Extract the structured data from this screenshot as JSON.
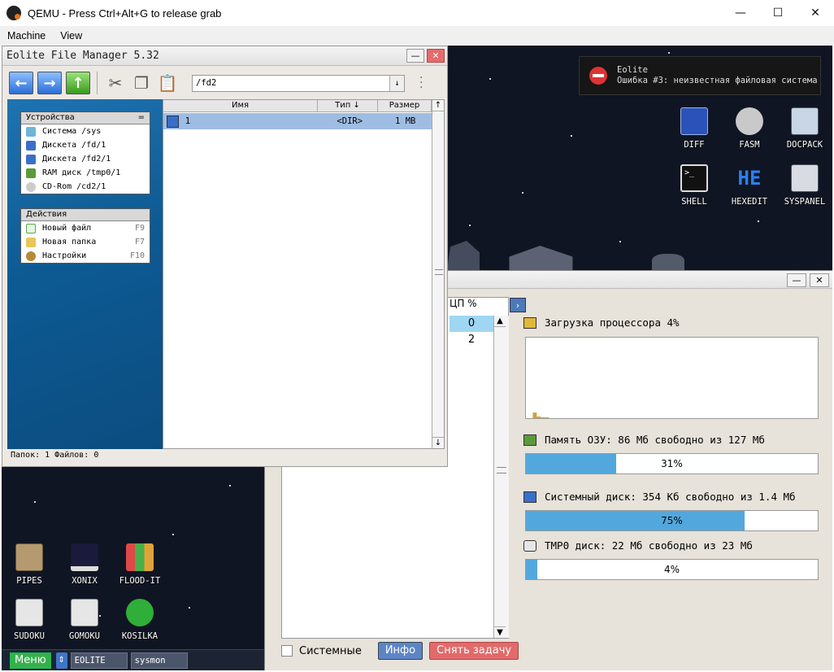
{
  "qemu": {
    "title": "QEMU - Press Ctrl+Alt+G to release grab",
    "menu": [
      "Machine",
      "View"
    ],
    "controls": {
      "minimize": "—",
      "maximize": "☐",
      "close": "✕"
    }
  },
  "notification": {
    "app": "Eolite",
    "message": "Ошибка #3: неизвестная файловая система"
  },
  "desktop_icons": [
    {
      "label": "DIFF",
      "icon": "diff-icon",
      "color": "#2b52b8"
    },
    {
      "label": "FASM",
      "icon": "fasm-icon",
      "color": "#c9c9c9"
    },
    {
      "label": "DOCPACK",
      "icon": "docpack-icon",
      "color": "#c8d6e6"
    },
    {
      "label": "SHELL",
      "icon": "shell-icon",
      "color": "#111111"
    },
    {
      "label": "HEXEDIT",
      "icon": "hexedit-icon",
      "color": "#1f6bd9"
    },
    {
      "label": "SYSPANEL",
      "icon": "syspanel-icon",
      "color": "#d8dbe2"
    },
    {
      "label": "PIPES",
      "icon": "pipes-icon",
      "color": "#b49a6e"
    },
    {
      "label": "XONIX",
      "icon": "xonix-icon",
      "color": "#1a1a3a"
    },
    {
      "label": "FLOOD-IT",
      "icon": "flood-it-icon",
      "color": "#e0a23a"
    },
    {
      "label": "SUDOKU",
      "icon": "sudoku-icon",
      "color": "#e6e6e6"
    },
    {
      "label": "GOMOKU",
      "icon": "gomoku-icon",
      "color": "#e6e6e6"
    },
    {
      "label": "KOSILKA",
      "icon": "kosilka-icon",
      "color": "#2fae3a"
    }
  ],
  "file_manager": {
    "title": "Eolite File Manager 5.32",
    "window_minimize": "—",
    "window_close": "✕",
    "path": "/fd2",
    "devices_header": "Устройства",
    "devices_menu_glyph": "=",
    "devices": [
      {
        "label": "Система /sys",
        "icon": "system-icon"
      },
      {
        "label": "Дискета /fd/1",
        "icon": "floppy-icon"
      },
      {
        "label": "Дискета /fd2/1",
        "icon": "floppy-icon"
      },
      {
        "label": "RAM диск /tmp0/1",
        "icon": "ram-disk-icon"
      },
      {
        "label": "CD-Rom /cd2/1",
        "icon": "cdrom-icon"
      }
    ],
    "actions_header": "Действия",
    "actions": [
      {
        "label": "Новый файл",
        "key": "F9",
        "icon": "new-file-icon"
      },
      {
        "label": "Новая папка",
        "key": "F7",
        "icon": "new-folder-icon"
      },
      {
        "label": "Настройки",
        "key": "F10",
        "icon": "settings-icon"
      }
    ],
    "columns": {
      "name": "Имя",
      "type": "Тип ↓",
      "size": "Размер"
    },
    "rows": [
      {
        "name": "1",
        "type": "<DIR>",
        "size": "1 MB"
      }
    ],
    "status": "Папок: 1  Файлов: 0"
  },
  "sysmon": {
    "window_minimize": "—",
    "window_close": "✕",
    "proc_header": "ЦП %",
    "proc_values": [
      "0",
      "2"
    ],
    "cpu_label": "Загрузка процессора 4%",
    "cpu_history": [
      7,
      2,
      1,
      1
    ],
    "ram_label": "Память ОЗУ: 86 Мб свободно из 127 Мб",
    "ram_percent": 31,
    "ram_text": "31%",
    "sysdisk_label": "Системный диск: 354 Кб свободно из 1.4 Мб",
    "sysdisk_percent": 75,
    "sysdisk_text": "75%",
    "tmp_label": "TMP0 диск: 22 Мб свободно из 23 Мб",
    "tmp_percent": 4,
    "tmp_text": "4%",
    "checkbox_label": "Системные",
    "info_button": "Инфо",
    "kill_button": "Снять задачу"
  },
  "taskbar": {
    "menu": "Меню",
    "switch_glyph": "⇕",
    "tasks": [
      "EOLITE",
      "sysmon"
    ]
  },
  "colors": {
    "accent": "#52a8dd",
    "desktop": "#101523",
    "selection": "#9fbde2",
    "danger": "#e26a6a"
  }
}
